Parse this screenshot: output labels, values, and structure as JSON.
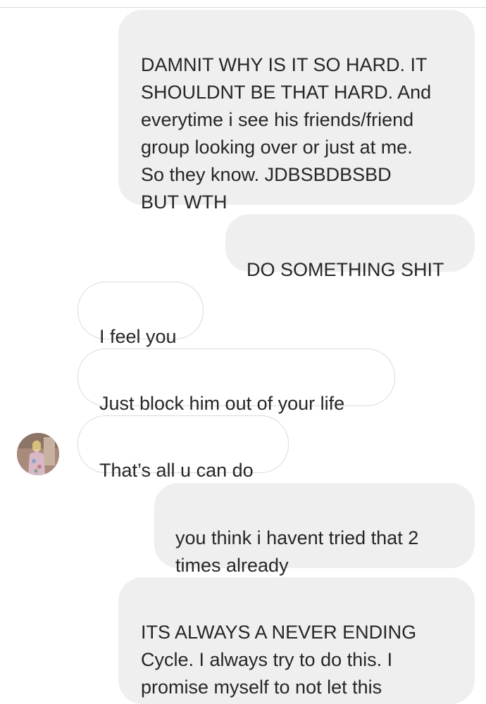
{
  "messages": [
    {
      "sender": "me",
      "text": "DAMNIT WHY IS IT SO HARD. IT\nSHOULDNT BE THAT HARD. And\neverytime i see his friends/friend\ngroup looking over or just at me.\nSo they know. JDBSBDBSBD\nBUT WTH"
    },
    {
      "sender": "me",
      "text": "DO SOMETHING SHIT"
    },
    {
      "sender": "other",
      "text": "I feel you"
    },
    {
      "sender": "other",
      "text": "Just block him out of your life"
    },
    {
      "sender": "other",
      "text": "That’s all u can do"
    },
    {
      "sender": "me",
      "text": "you think i havent tried that 2\ntimes already"
    },
    {
      "sender": "me",
      "text": "ITS ALWAYS A NEVER ENDING\nCycle. I always try to do this. I\npromise myself to not let this"
    }
  ],
  "colors": {
    "sent_bubble": "#efefef",
    "received_border": "#dbdbdb",
    "text": "#262626"
  }
}
